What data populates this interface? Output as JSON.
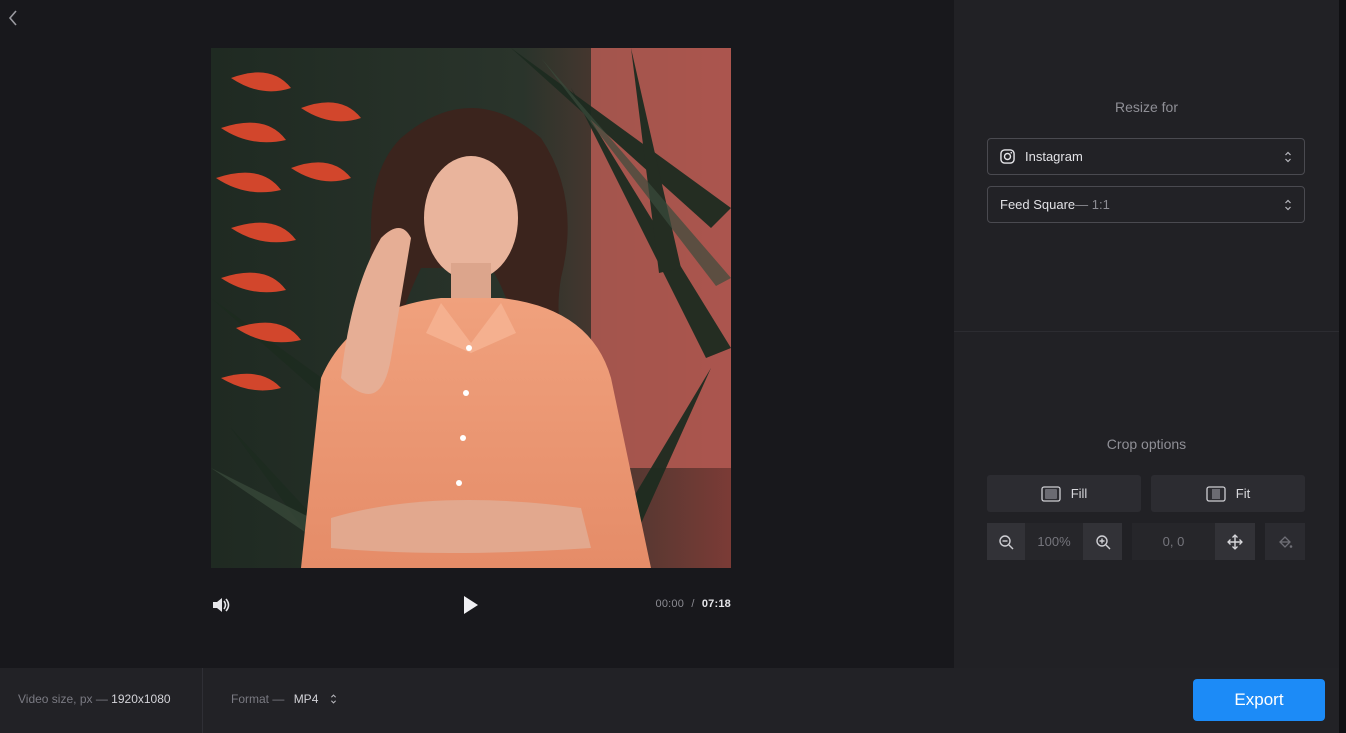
{
  "preview": {
    "back_icon": "chevron-left-icon",
    "image": "woman-in-orange-shirt-portrait",
    "player": {
      "volume_icon": "speaker-icon",
      "play_icon": "play-icon",
      "current_time": "00:00",
      "separator": "/",
      "total_time": "07:18"
    }
  },
  "resize": {
    "title": "Resize for",
    "platform": {
      "icon": "instagram-icon",
      "value": "Instagram"
    },
    "preset": {
      "value": "Feed Square",
      "ratio": " — 1:1"
    }
  },
  "crop": {
    "title": "Crop options",
    "fill_label": "Fill",
    "fit_label": "Fit",
    "zoom_value": "100%",
    "position_value": "0, 0",
    "icons": [
      "zoom-out-icon",
      "zoom-in-icon",
      "move-icon",
      "paint-bucket-icon"
    ]
  },
  "footer": {
    "video_size_label": "Video size, px —",
    "video_size_value": "1920x1080",
    "format_label": "Format —",
    "format_value": "MP4",
    "export_label": "Export"
  },
  "colors": {
    "accent": "#1c8bf7",
    "panel_bg": "#212125",
    "preview_bg": "#18181c"
  }
}
